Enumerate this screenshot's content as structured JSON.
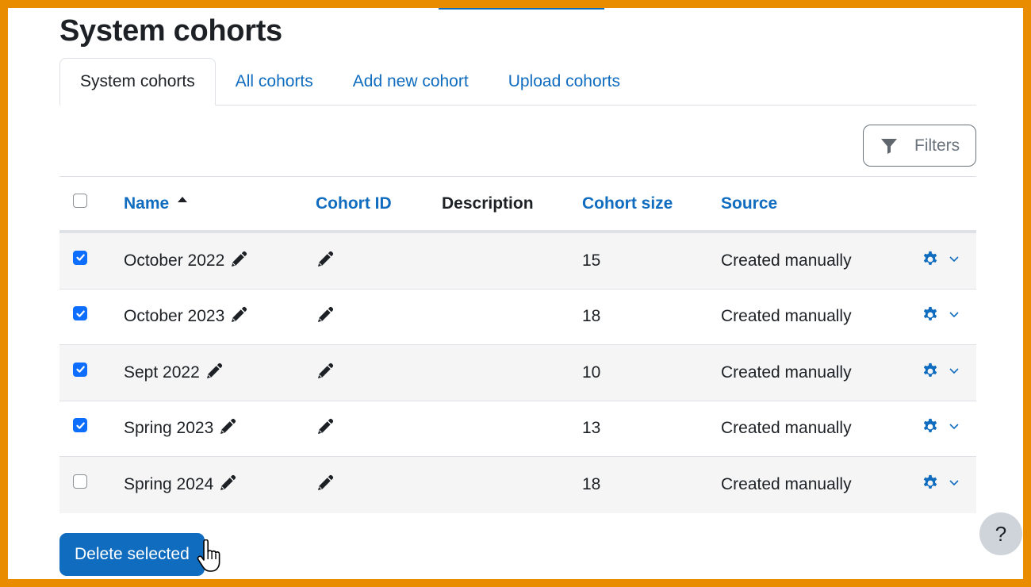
{
  "page": {
    "title": "System cohorts"
  },
  "tabs": [
    {
      "label": "System cohorts",
      "active": true
    },
    {
      "label": "All cohorts",
      "active": false
    },
    {
      "label": "Add new cohort",
      "active": false
    },
    {
      "label": "Upload cohorts",
      "active": false
    }
  ],
  "filters": {
    "label": "Filters",
    "icon": "filter-icon"
  },
  "table": {
    "select_all_checked": false,
    "headers": {
      "name": "Name",
      "name_sort": "ascending",
      "cohort_id": "Cohort ID",
      "description": "Description",
      "cohort_size": "Cohort size",
      "source": "Source"
    },
    "rows": [
      {
        "checked": true,
        "name": "October 2022",
        "cohort_id": "",
        "description": "",
        "size": "15",
        "source": "Created manually"
      },
      {
        "checked": true,
        "name": "October 2023",
        "cohort_id": "",
        "description": "",
        "size": "18",
        "source": "Created manually"
      },
      {
        "checked": true,
        "name": "Sept 2022",
        "cohort_id": "",
        "description": "",
        "size": "10",
        "source": "Created manually"
      },
      {
        "checked": true,
        "name": "Spring 2023",
        "cohort_id": "",
        "description": "",
        "size": "13",
        "source": "Created manually"
      },
      {
        "checked": false,
        "name": "Spring 2024",
        "cohort_id": "",
        "description": "",
        "size": "18",
        "source": "Created manually"
      }
    ]
  },
  "actions": {
    "delete_selected": "Delete selected"
  },
  "help": {
    "label": "?"
  },
  "colors": {
    "accent": "#0f6cbf",
    "frame": "#ea8c00",
    "checkbox_checked": "#0d6efd",
    "stripe": "#f5f5f5"
  }
}
